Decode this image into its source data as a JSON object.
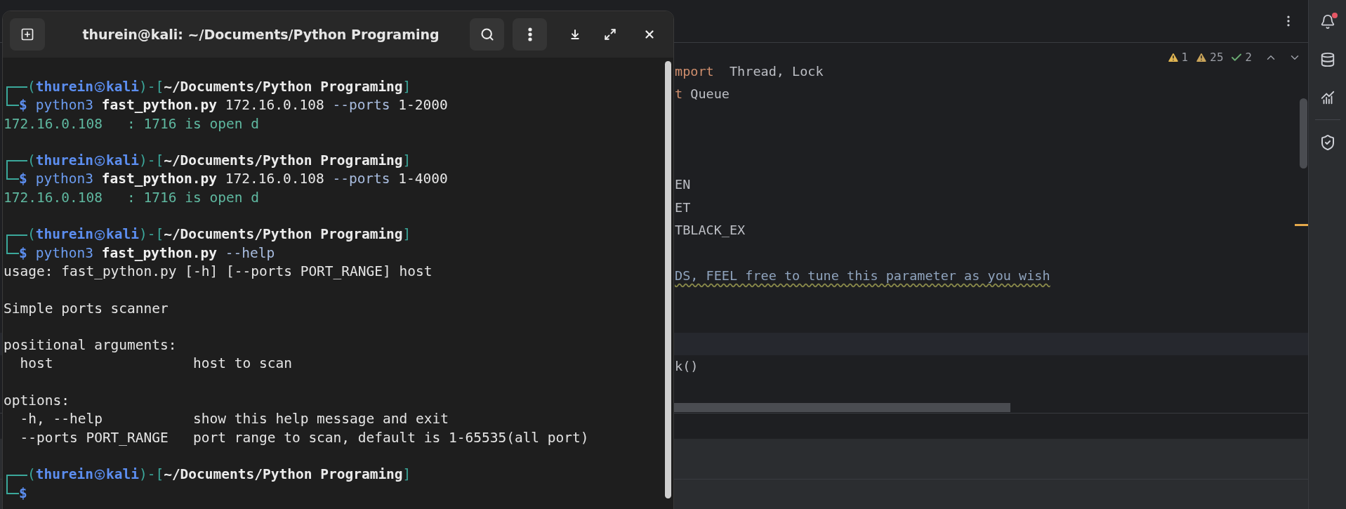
{
  "terminal": {
    "title": "thurein@kali: ~/Documents/Python Programing",
    "lines": [
      {
        "kind": "prompt",
        "segments": [
          {
            "kind": "frame",
            "text": "("
          },
          {
            "kind": "user",
            "text": "thurein"
          },
          {
            "kind": "symbol"
          },
          {
            "kind": "host",
            "text": "kali"
          },
          {
            "kind": "frame",
            "text": ")-["
          },
          {
            "kind": "path",
            "text": "~/Documents/Python Programing"
          },
          {
            "kind": "frame",
            "text": "]"
          }
        ]
      },
      {
        "kind": "command",
        "sign": "$",
        "tokens": [
          {
            "kind": "program",
            "text": "python3"
          },
          {
            "kind": "script",
            "text": "fast_python.py"
          },
          {
            "kind": "arg",
            "text": "172.16.0.108"
          },
          {
            "kind": "option",
            "text": "--ports"
          },
          {
            "kind": "arg",
            "text": "1-2000"
          }
        ]
      },
      {
        "kind": "output",
        "success": true,
        "text": "172.16.0.108   : 1716 is open d"
      },
      {
        "kind": "blank"
      },
      {
        "kind": "prompt",
        "segments": [
          {
            "kind": "frame",
            "text": "("
          },
          {
            "kind": "user",
            "text": "thurein"
          },
          {
            "kind": "symbol"
          },
          {
            "kind": "host",
            "text": "kali"
          },
          {
            "kind": "frame",
            "text": ")-["
          },
          {
            "kind": "path",
            "text": "~/Documents/Python Programing"
          },
          {
            "kind": "frame",
            "text": "]"
          }
        ]
      },
      {
        "kind": "command",
        "sign": "$",
        "tokens": [
          {
            "kind": "program",
            "text": "python3"
          },
          {
            "kind": "script",
            "text": "fast_python.py"
          },
          {
            "kind": "arg",
            "text": "172.16.0.108"
          },
          {
            "kind": "option",
            "text": "--ports"
          },
          {
            "kind": "arg",
            "text": "1-4000"
          }
        ]
      },
      {
        "kind": "output",
        "success": true,
        "text": "172.16.0.108   : 1716 is open d"
      },
      {
        "kind": "blank"
      },
      {
        "kind": "prompt",
        "segments": [
          {
            "kind": "frame",
            "text": "("
          },
          {
            "kind": "user",
            "text": "thurein"
          },
          {
            "kind": "symbol"
          },
          {
            "kind": "host",
            "text": "kali"
          },
          {
            "kind": "frame",
            "text": ")-["
          },
          {
            "kind": "path",
            "text": "~/Documents/Python Programing"
          },
          {
            "kind": "frame",
            "text": "]"
          }
        ]
      },
      {
        "kind": "command",
        "sign": "$",
        "tokens": [
          {
            "kind": "program",
            "text": "python3"
          },
          {
            "kind": "script",
            "text": "fast_python.py"
          },
          {
            "kind": "option",
            "text": "--help"
          }
        ]
      },
      {
        "kind": "output",
        "success": false,
        "text": "usage: fast_python.py [-h] [--ports PORT_RANGE] host"
      },
      {
        "kind": "blank"
      },
      {
        "kind": "output",
        "success": false,
        "text": "Simple ports scanner"
      },
      {
        "kind": "blank"
      },
      {
        "kind": "output",
        "success": false,
        "text": "positional arguments:"
      },
      {
        "kind": "output",
        "success": false,
        "text": "  host                 host to scan"
      },
      {
        "kind": "blank"
      },
      {
        "kind": "output",
        "success": false,
        "text": "options:"
      },
      {
        "kind": "output",
        "success": false,
        "text": "  -h, --help           show this help message and exit"
      },
      {
        "kind": "output",
        "success": false,
        "text": "  --ports PORT_RANGE   port range to scan, default is 1-65535(all port)"
      },
      {
        "kind": "blank"
      },
      {
        "kind": "prompt",
        "segments": [
          {
            "kind": "frame",
            "text": "("
          },
          {
            "kind": "user",
            "text": "thurein"
          },
          {
            "kind": "symbol"
          },
          {
            "kind": "host",
            "text": "kali"
          },
          {
            "kind": "frame",
            "text": ")-["
          },
          {
            "kind": "path",
            "text": "~/Documents/Python Programing"
          },
          {
            "kind": "frame",
            "text": "]"
          }
        ]
      },
      {
        "kind": "command",
        "sign": "$"
      }
    ]
  },
  "ide": {
    "notifications": {
      "unread": true
    },
    "inspections": [
      {
        "kind": "warning",
        "count": "1"
      },
      {
        "kind": "weak_warning",
        "count": "25"
      },
      {
        "kind": "typo",
        "count": "2"
      }
    ],
    "code_lines": [
      {
        "kind": "code",
        "current": false,
        "tokens": [
          {
            "kind": "keyword",
            "text": "mport"
          },
          {
            "kind": "plain",
            "text": "  Thread, Lock"
          }
        ]
      },
      {
        "kind": "code",
        "current": false,
        "tokens": [
          {
            "kind": "keyword",
            "text": "t"
          },
          {
            "kind": "plain",
            "text": " Queue"
          }
        ]
      },
      {
        "kind": "blank",
        "current": false
      },
      {
        "kind": "blank",
        "current": false
      },
      {
        "kind": "blank",
        "current": false
      },
      {
        "kind": "code",
        "current": false,
        "tokens": [
          {
            "kind": "plain",
            "text": "EN"
          }
        ]
      },
      {
        "kind": "code",
        "current": false,
        "tokens": [
          {
            "kind": "plain",
            "text": "ET"
          }
        ]
      },
      {
        "kind": "code",
        "current": false,
        "tokens": [
          {
            "kind": "plain",
            "text": "TBLACK_EX"
          }
        ]
      },
      {
        "kind": "blank",
        "current": false
      },
      {
        "kind": "code",
        "current": false,
        "tokens": [
          {
            "kind": "comment",
            "text": "DS, FEEL free to tune this parameter as you wish",
            "flagged": true
          }
        ]
      },
      {
        "kind": "blank",
        "current": false
      },
      {
        "kind": "blank",
        "current": false
      },
      {
        "kind": "blank",
        "current": true
      },
      {
        "kind": "code",
        "current": false,
        "tokens": [
          {
            "kind": "plain",
            "text": "k()"
          }
        ]
      }
    ]
  }
}
